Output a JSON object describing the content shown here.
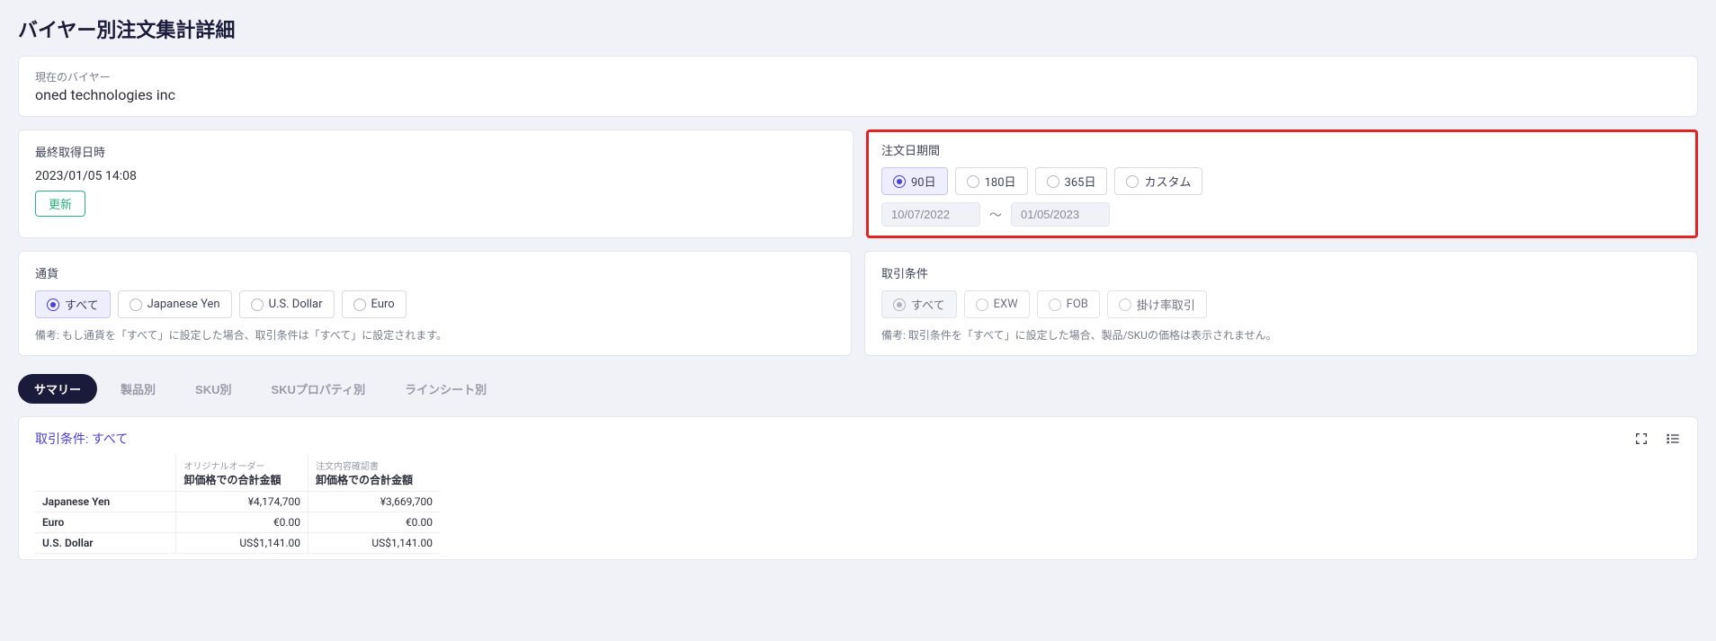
{
  "page": {
    "title": "バイヤー別注文集計詳細"
  },
  "buyer": {
    "label": "現在のバイヤー",
    "name": "oned technologies inc"
  },
  "fetch": {
    "label": "最終取得日時",
    "timestamp": "2023/01/05 14:08",
    "update_button": "更新"
  },
  "period": {
    "label": "注文日期間",
    "options": {
      "d90": "90日",
      "d180": "180日",
      "d365": "365日",
      "custom": "カスタム"
    },
    "from": "10/07/2022",
    "to": "01/05/2023",
    "tilde": "〜"
  },
  "currency": {
    "label": "通貨",
    "options": {
      "all": "すべて",
      "jpy": "Japanese Yen",
      "usd": "U.S. Dollar",
      "eur": "Euro"
    },
    "note": "備考: もし通貨を「すべて」に設定した場合、取引条件は「すべて」に設定されます。"
  },
  "terms": {
    "label": "取引条件",
    "options": {
      "all": "すべて",
      "exw": "EXW",
      "fob": "FOB",
      "rate": "掛け率取引"
    },
    "note": "備考: 取引条件を「すべて」に設定した場合、製品/SKUの価格は表示されません。"
  },
  "tabs": {
    "summary": "サマリー",
    "by_product": "製品別",
    "by_sku": "SKU別",
    "by_sku_prop": "SKUプロパティ別",
    "by_linesheet": "ラインシート別"
  },
  "summary": {
    "title": "取引条件: すべて",
    "col1_super": "オリジナルオーダー",
    "col1_sub": "卸価格での合計金額",
    "col2_super": "注文内容確認書",
    "col2_sub": "卸価格での合計金額",
    "rows": [
      {
        "label": "Japanese Yen",
        "orig": "¥4,174,700",
        "conf": "¥3,669,700"
      },
      {
        "label": "Euro",
        "orig": "€0.00",
        "conf": "€0.00"
      },
      {
        "label": "U.S. Dollar",
        "orig": "US$1,141.00",
        "conf": "US$1,141.00"
      }
    ]
  }
}
